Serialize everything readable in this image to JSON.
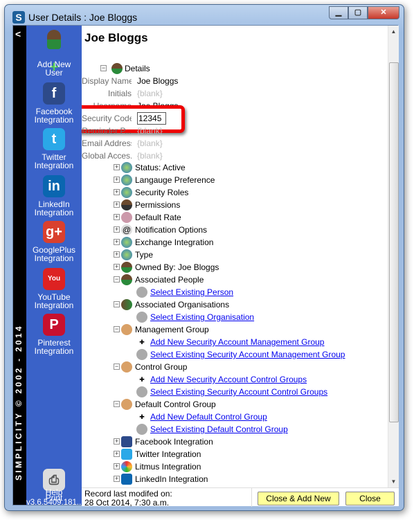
{
  "window": {
    "title": "User Details : Joe Bloggs",
    "app_icon_letter": "S"
  },
  "brand": "SIMPLICITY © 2002 - 2014",
  "sidebar": {
    "items": [
      {
        "label1": "Add New",
        "label2": "User",
        "icon": "add-user-icon",
        "color": "#2a8a3a"
      },
      {
        "label1": "Facebook",
        "label2": "Integration",
        "icon": "facebook-icon",
        "glyph": "f",
        "color": "#2d4a8a"
      },
      {
        "label1": "Twitter",
        "label2": "Integration",
        "icon": "twitter-icon",
        "glyph": "t",
        "color": "#2aa8e8"
      },
      {
        "label1": "LinkedIn",
        "label2": "Integration",
        "icon": "linkedin-icon",
        "glyph": "in",
        "color": "#0a66b0"
      },
      {
        "label1": "GooglePlus",
        "label2": "Integration",
        "icon": "googleplus-icon",
        "glyph": "g+",
        "color": "#d9402e"
      },
      {
        "label1": "YouTube",
        "label2": "Integration",
        "icon": "youtube-icon",
        "glyph": "You",
        "color": "#d22"
      },
      {
        "label1": "Pinterest",
        "label2": "Integration",
        "icon": "pinterest-icon",
        "glyph": "P",
        "color": "#c8102e"
      }
    ],
    "print": "Print",
    "help": "Help",
    "version": "v3.6.5409.181..."
  },
  "header": {
    "title": "Joe Bloggs"
  },
  "details": {
    "label": "Details",
    "fields": [
      {
        "label": "Display Name",
        "value": "Joe Bloggs",
        "blank": false
      },
      {
        "label": "Initials",
        "value": "{blank}",
        "blank": true
      },
      {
        "label": "Username",
        "value": "Joe Bloggs",
        "blank": false
      },
      {
        "label": "Security Code",
        "value": "12345",
        "blank": false,
        "editing": true
      },
      {
        "label": "Reminder P...",
        "value": "{blank}",
        "blank": true
      },
      {
        "label": "Email Address",
        "value": "{blank}",
        "blank": true
      },
      {
        "label": "Global Acces...",
        "value": "{blank}",
        "blank": true
      }
    ]
  },
  "tree": [
    {
      "level": 1,
      "exp": "+",
      "text": "Status:  Active",
      "icon": "globe-icon"
    },
    {
      "level": 1,
      "exp": "+",
      "text": "Langauge Preference",
      "icon": "globe-icon"
    },
    {
      "level": 1,
      "exp": "+",
      "text": "Security Roles",
      "icon": "globe-icon"
    },
    {
      "level": 1,
      "exp": "+",
      "text": "Permissions",
      "icon": "user-key-icon"
    },
    {
      "level": 1,
      "exp": "+",
      "text": "Default Rate",
      "icon": "rate-icon"
    },
    {
      "level": 1,
      "exp": "+",
      "text": "Notification Options",
      "icon": "at-icon"
    },
    {
      "level": 1,
      "exp": "+",
      "text": "Exchange Integration",
      "icon": "globe-icon"
    },
    {
      "level": 1,
      "exp": "+",
      "text": "Type",
      "icon": "globe-icon"
    },
    {
      "level": 1,
      "exp": "+",
      "text": "Owned By:  Joe Bloggs",
      "icon": "user-icon"
    },
    {
      "level": 1,
      "exp": "-",
      "text": "Associated People",
      "icon": "user-icon"
    },
    {
      "level": 2,
      "link": true,
      "text": "Select Existing Person",
      "icon": "link-icon"
    },
    {
      "level": 1,
      "exp": "-",
      "text": "Associated Organisations",
      "icon": "group-icon"
    },
    {
      "level": 2,
      "link": true,
      "text": "Select Existing Organisation",
      "icon": "link-icon"
    },
    {
      "level": 1,
      "exp": "-",
      "text": "Management Group",
      "icon": "handshake-icon"
    },
    {
      "level": 2,
      "link": true,
      "text": "Add New Security Account Management Group",
      "icon": "plus-icon"
    },
    {
      "level": 2,
      "link": true,
      "text": "Select Existing Security Account Management Group",
      "icon": "link-icon"
    },
    {
      "level": 1,
      "exp": "-",
      "text": "Control Group",
      "icon": "handshake-icon"
    },
    {
      "level": 2,
      "link": true,
      "text": "Add New Security Account Control Groups",
      "icon": "plus-icon"
    },
    {
      "level": 2,
      "link": true,
      "text": "Select Existing Security Account Control Groups",
      "icon": "link-icon"
    },
    {
      "level": 1,
      "exp": "-",
      "text": "Default Control Group",
      "icon": "handshake-icon"
    },
    {
      "level": 2,
      "link": true,
      "text": "Add New Default Control Group",
      "icon": "plus-icon"
    },
    {
      "level": 2,
      "link": true,
      "text": "Select Existing Default Control Group",
      "icon": "link-icon"
    },
    {
      "level": 1,
      "exp": "+",
      "text": "Facebook Integration",
      "icon": "facebook-icon"
    },
    {
      "level": 1,
      "exp": "+",
      "text": "Twitter Integration",
      "icon": "twitter-icon"
    },
    {
      "level": 1,
      "exp": "+",
      "text": "Litmus Integration",
      "icon": "litmus-icon"
    },
    {
      "level": 1,
      "exp": "+",
      "text": "LinkedIn Integration",
      "icon": "linkedin-icon"
    }
  ],
  "footer": {
    "status1": "Record last modifed on:",
    "status2": "28 Oct 2014, 7:30 a.m.",
    "close_add_new": "Close & Add New",
    "close": "Close"
  },
  "colors": {
    "sidebar": "#3a62c8",
    "highlight": "#e00000",
    "button": "#ffff99"
  }
}
